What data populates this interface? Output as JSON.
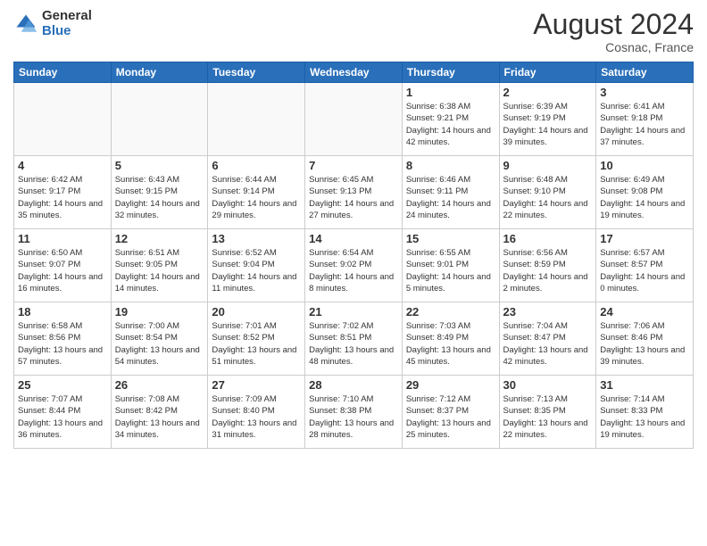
{
  "header": {
    "logo_general": "General",
    "logo_blue": "Blue",
    "month_year": "August 2024",
    "location": "Cosnac, France"
  },
  "days_of_week": [
    "Sunday",
    "Monday",
    "Tuesday",
    "Wednesday",
    "Thursday",
    "Friday",
    "Saturday"
  ],
  "weeks": [
    [
      {
        "day": "",
        "info": ""
      },
      {
        "day": "",
        "info": ""
      },
      {
        "day": "",
        "info": ""
      },
      {
        "day": "",
        "info": ""
      },
      {
        "day": "1",
        "info": "Sunrise: 6:38 AM\nSunset: 9:21 PM\nDaylight: 14 hours\nand 42 minutes."
      },
      {
        "day": "2",
        "info": "Sunrise: 6:39 AM\nSunset: 9:19 PM\nDaylight: 14 hours\nand 39 minutes."
      },
      {
        "day": "3",
        "info": "Sunrise: 6:41 AM\nSunset: 9:18 PM\nDaylight: 14 hours\nand 37 minutes."
      }
    ],
    [
      {
        "day": "4",
        "info": "Sunrise: 6:42 AM\nSunset: 9:17 PM\nDaylight: 14 hours\nand 35 minutes."
      },
      {
        "day": "5",
        "info": "Sunrise: 6:43 AM\nSunset: 9:15 PM\nDaylight: 14 hours\nand 32 minutes."
      },
      {
        "day": "6",
        "info": "Sunrise: 6:44 AM\nSunset: 9:14 PM\nDaylight: 14 hours\nand 29 minutes."
      },
      {
        "day": "7",
        "info": "Sunrise: 6:45 AM\nSunset: 9:13 PM\nDaylight: 14 hours\nand 27 minutes."
      },
      {
        "day": "8",
        "info": "Sunrise: 6:46 AM\nSunset: 9:11 PM\nDaylight: 14 hours\nand 24 minutes."
      },
      {
        "day": "9",
        "info": "Sunrise: 6:48 AM\nSunset: 9:10 PM\nDaylight: 14 hours\nand 22 minutes."
      },
      {
        "day": "10",
        "info": "Sunrise: 6:49 AM\nSunset: 9:08 PM\nDaylight: 14 hours\nand 19 minutes."
      }
    ],
    [
      {
        "day": "11",
        "info": "Sunrise: 6:50 AM\nSunset: 9:07 PM\nDaylight: 14 hours\nand 16 minutes."
      },
      {
        "day": "12",
        "info": "Sunrise: 6:51 AM\nSunset: 9:05 PM\nDaylight: 14 hours\nand 14 minutes."
      },
      {
        "day": "13",
        "info": "Sunrise: 6:52 AM\nSunset: 9:04 PM\nDaylight: 14 hours\nand 11 minutes."
      },
      {
        "day": "14",
        "info": "Sunrise: 6:54 AM\nSunset: 9:02 PM\nDaylight: 14 hours\nand 8 minutes."
      },
      {
        "day": "15",
        "info": "Sunrise: 6:55 AM\nSunset: 9:01 PM\nDaylight: 14 hours\nand 5 minutes."
      },
      {
        "day": "16",
        "info": "Sunrise: 6:56 AM\nSunset: 8:59 PM\nDaylight: 14 hours\nand 2 minutes."
      },
      {
        "day": "17",
        "info": "Sunrise: 6:57 AM\nSunset: 8:57 PM\nDaylight: 14 hours\nand 0 minutes."
      }
    ],
    [
      {
        "day": "18",
        "info": "Sunrise: 6:58 AM\nSunset: 8:56 PM\nDaylight: 13 hours\nand 57 minutes."
      },
      {
        "day": "19",
        "info": "Sunrise: 7:00 AM\nSunset: 8:54 PM\nDaylight: 13 hours\nand 54 minutes."
      },
      {
        "day": "20",
        "info": "Sunrise: 7:01 AM\nSunset: 8:52 PM\nDaylight: 13 hours\nand 51 minutes."
      },
      {
        "day": "21",
        "info": "Sunrise: 7:02 AM\nSunset: 8:51 PM\nDaylight: 13 hours\nand 48 minutes."
      },
      {
        "day": "22",
        "info": "Sunrise: 7:03 AM\nSunset: 8:49 PM\nDaylight: 13 hours\nand 45 minutes."
      },
      {
        "day": "23",
        "info": "Sunrise: 7:04 AM\nSunset: 8:47 PM\nDaylight: 13 hours\nand 42 minutes."
      },
      {
        "day": "24",
        "info": "Sunrise: 7:06 AM\nSunset: 8:46 PM\nDaylight: 13 hours\nand 39 minutes."
      }
    ],
    [
      {
        "day": "25",
        "info": "Sunrise: 7:07 AM\nSunset: 8:44 PM\nDaylight: 13 hours\nand 36 minutes."
      },
      {
        "day": "26",
        "info": "Sunrise: 7:08 AM\nSunset: 8:42 PM\nDaylight: 13 hours\nand 34 minutes."
      },
      {
        "day": "27",
        "info": "Sunrise: 7:09 AM\nSunset: 8:40 PM\nDaylight: 13 hours\nand 31 minutes."
      },
      {
        "day": "28",
        "info": "Sunrise: 7:10 AM\nSunset: 8:38 PM\nDaylight: 13 hours\nand 28 minutes."
      },
      {
        "day": "29",
        "info": "Sunrise: 7:12 AM\nSunset: 8:37 PM\nDaylight: 13 hours\nand 25 minutes."
      },
      {
        "day": "30",
        "info": "Sunrise: 7:13 AM\nSunset: 8:35 PM\nDaylight: 13 hours\nand 22 minutes."
      },
      {
        "day": "31",
        "info": "Sunrise: 7:14 AM\nSunset: 8:33 PM\nDaylight: 13 hours\nand 19 minutes."
      }
    ]
  ]
}
